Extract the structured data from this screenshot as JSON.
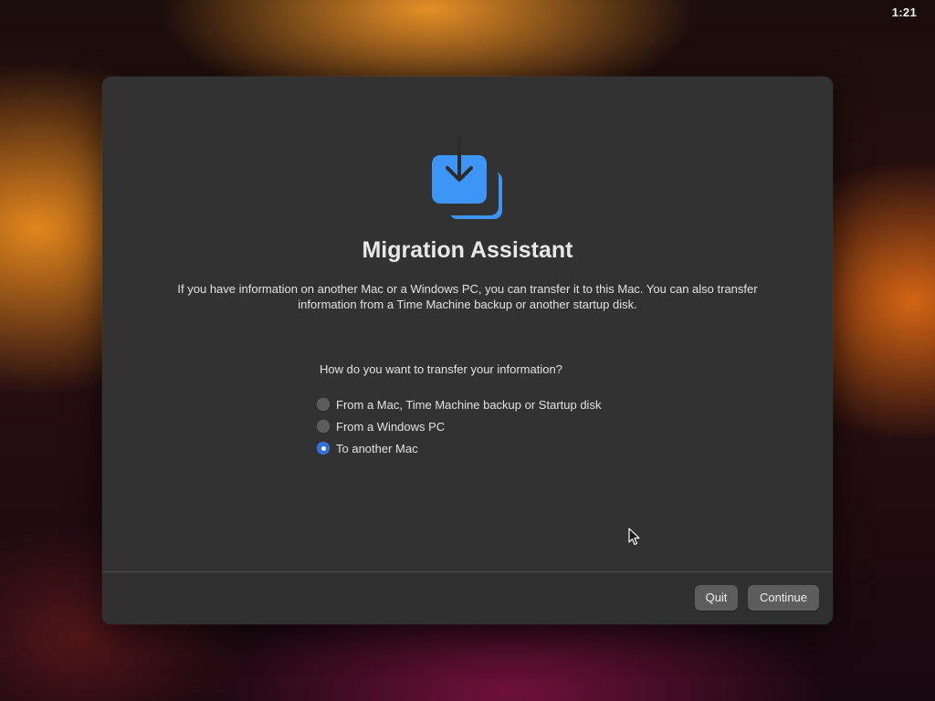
{
  "menu_bar": {
    "clock": "1:21"
  },
  "window": {
    "app_icon": "migration-assistant-icon",
    "title": "Migration Assistant",
    "description": "If you have information on another Mac or a Windows PC, you can transfer it to this Mac. You can also transfer information from a Time Machine backup or another startup disk.",
    "question": "How do you want to transfer your information?",
    "options": [
      {
        "label": "From a Mac, Time Machine backup or Startup disk",
        "selected": false
      },
      {
        "label": "From a Windows PC",
        "selected": false
      },
      {
        "label": "To another Mac",
        "selected": true
      }
    ],
    "buttons": {
      "quit": "Quit",
      "continue": "Continue"
    }
  },
  "colors": {
    "accent": "#2f6fe0",
    "icon_blue": "#3d95f5",
    "window_bg": "#323232"
  }
}
